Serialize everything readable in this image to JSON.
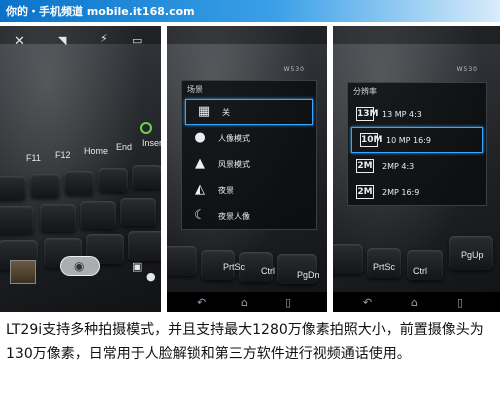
{
  "header": {
    "text": "你的・手机频道 mobile.it168.com"
  },
  "panel1": {
    "keys": [
      "F11",
      "F12",
      "Home",
      "End",
      "Insert"
    ],
    "icons": {
      "left": "tools-icon",
      "mid": "wifi-icon",
      "right": "battery-icon"
    }
  },
  "panel2": {
    "menu_title": "场景",
    "items": [
      {
        "label": "关",
        "icon": "grid-icon",
        "selected": true
      },
      {
        "label": "人像模式",
        "icon": "portrait-icon",
        "selected": false
      },
      {
        "label": "风景模式",
        "icon": "landscape-icon",
        "selected": false
      },
      {
        "label": "夜景",
        "icon": "night-icon",
        "selected": false
      },
      {
        "label": "夜景人像",
        "icon": "night-portrait-icon",
        "selected": false
      }
    ],
    "keys": [
      "PrtSc",
      "Ctrl",
      "PgDn"
    ],
    "badge": "W530"
  },
  "panel3": {
    "menu_title": "分辨率",
    "items": [
      {
        "label": "13 MP 4:3",
        "icon_text": "13M",
        "selected": false
      },
      {
        "label": "10 MP 16:9",
        "icon_text": "10M",
        "selected": true
      },
      {
        "label": "2MP 4:3",
        "icon_text": "2M",
        "selected": false
      },
      {
        "label": "2MP 16:9",
        "icon_text": "2M",
        "selected": false
      }
    ],
    "keys": [
      "PrtSc",
      "Ctrl",
      "PgUp"
    ],
    "badge": "W530"
  },
  "caption": "LT29i支持多种拍摄模式，并且支持最大1280万像素拍照大小，前置摄像头为130万像素，日常用于人脸解锁和第三方软件进行视频通话使用。",
  "colors": {
    "header_start": "#0a73c9",
    "header_end": "#d8ecfa",
    "highlight": "#3aa5ff",
    "led": "#6cd44a"
  }
}
